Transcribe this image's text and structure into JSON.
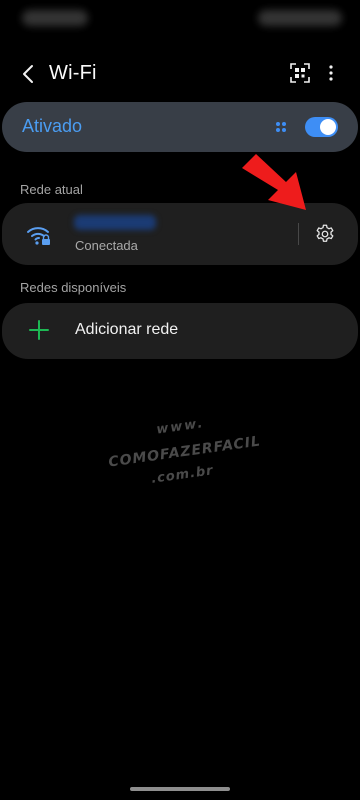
{
  "header": {
    "title": "Wi-Fi",
    "back_icon": "chevron-left-icon",
    "qr_icon": "qr-scan-icon",
    "more_icon": "more-vert-icon"
  },
  "wifi_toggle": {
    "label": "Ativado",
    "enabled": true,
    "accent": "#3e8ef5"
  },
  "current_network": {
    "section_label": "Rede atual",
    "status": "Conectada",
    "icon": "wifi-secured-icon",
    "settings_icon": "gear-icon"
  },
  "available_networks": {
    "section_label": "Redes disponíveis",
    "add_label": "Adicionar rede",
    "add_icon": "plus-icon",
    "add_color": "#1db954"
  },
  "watermark": {
    "line1": "www.",
    "line2": "COMOFAZERFACIL",
    "line3": ".com.br"
  }
}
